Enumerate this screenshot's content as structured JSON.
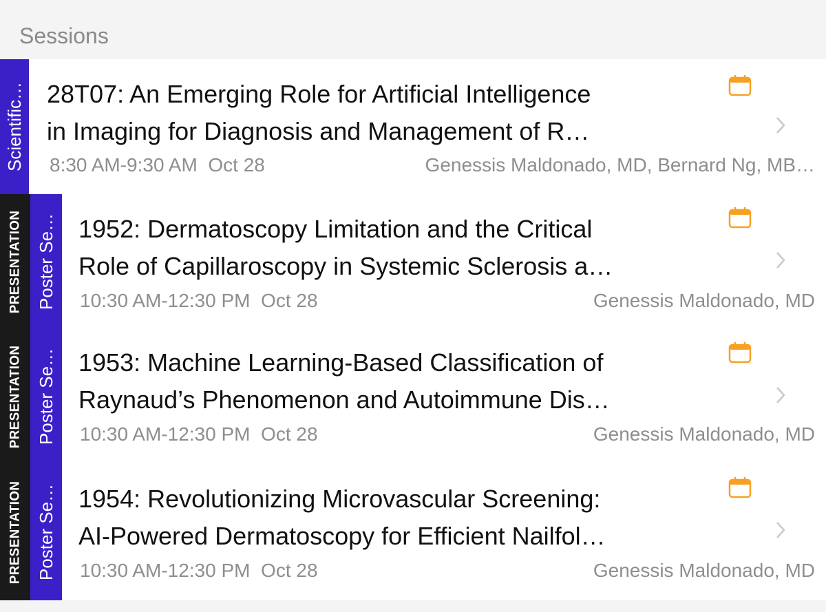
{
  "header": {
    "title": "Sessions"
  },
  "sessions": [
    {
      "type_label": "",
      "category_label": "Scientific…",
      "title_line1": "28T07: An Emerging Role for Artificial Intelligence",
      "title_line2": "in Imaging for Diagnosis and Management of R…",
      "time": "8:30 AM-9:30 AM",
      "date": "Oct 28",
      "speakers": "Genessis Maldonado, MD, Bernard Ng, MB…"
    },
    {
      "type_label": "PRESENTATION",
      "category_label": "Poster Se…",
      "title_line1": "1952: Dermatoscopy Limitation and the Critical",
      "title_line2": "Role of Capillaroscopy in Systemic Sclerosis a…",
      "time": "10:30 AM-12:30 PM",
      "date": "Oct 28",
      "speakers": "Genessis Maldonado, MD"
    },
    {
      "type_label": "PRESENTATION",
      "category_label": "Poster Se…",
      "title_line1": "1953: Machine Learning-Based Classification of",
      "title_line2": "Raynaud’s Phenomenon and Autoimmune Dis…",
      "time": "10:30 AM-12:30 PM",
      "date": "Oct 28",
      "speakers": "Genessis Maldonado, MD"
    },
    {
      "type_label": "PRESENTATION",
      "category_label": "Poster Se…",
      "title_line1": "1954: Revolutionizing Microvascular Screening:",
      "title_line2": "AI-Powered Dermatoscopy for Efficient Nailfol…",
      "time": "10:30 AM-12:30 PM",
      "date": "Oct 28",
      "speakers": "Genessis Maldonado, MD"
    }
  ],
  "icons": {
    "calendar": "calendar-icon",
    "chevron": "chevron-right-icon"
  },
  "colors": {
    "category_tab": "#3b20c8",
    "type_tab": "#1a1a1a",
    "calendar_accent": "#f7a023",
    "chevron": "#c7c7cc"
  }
}
